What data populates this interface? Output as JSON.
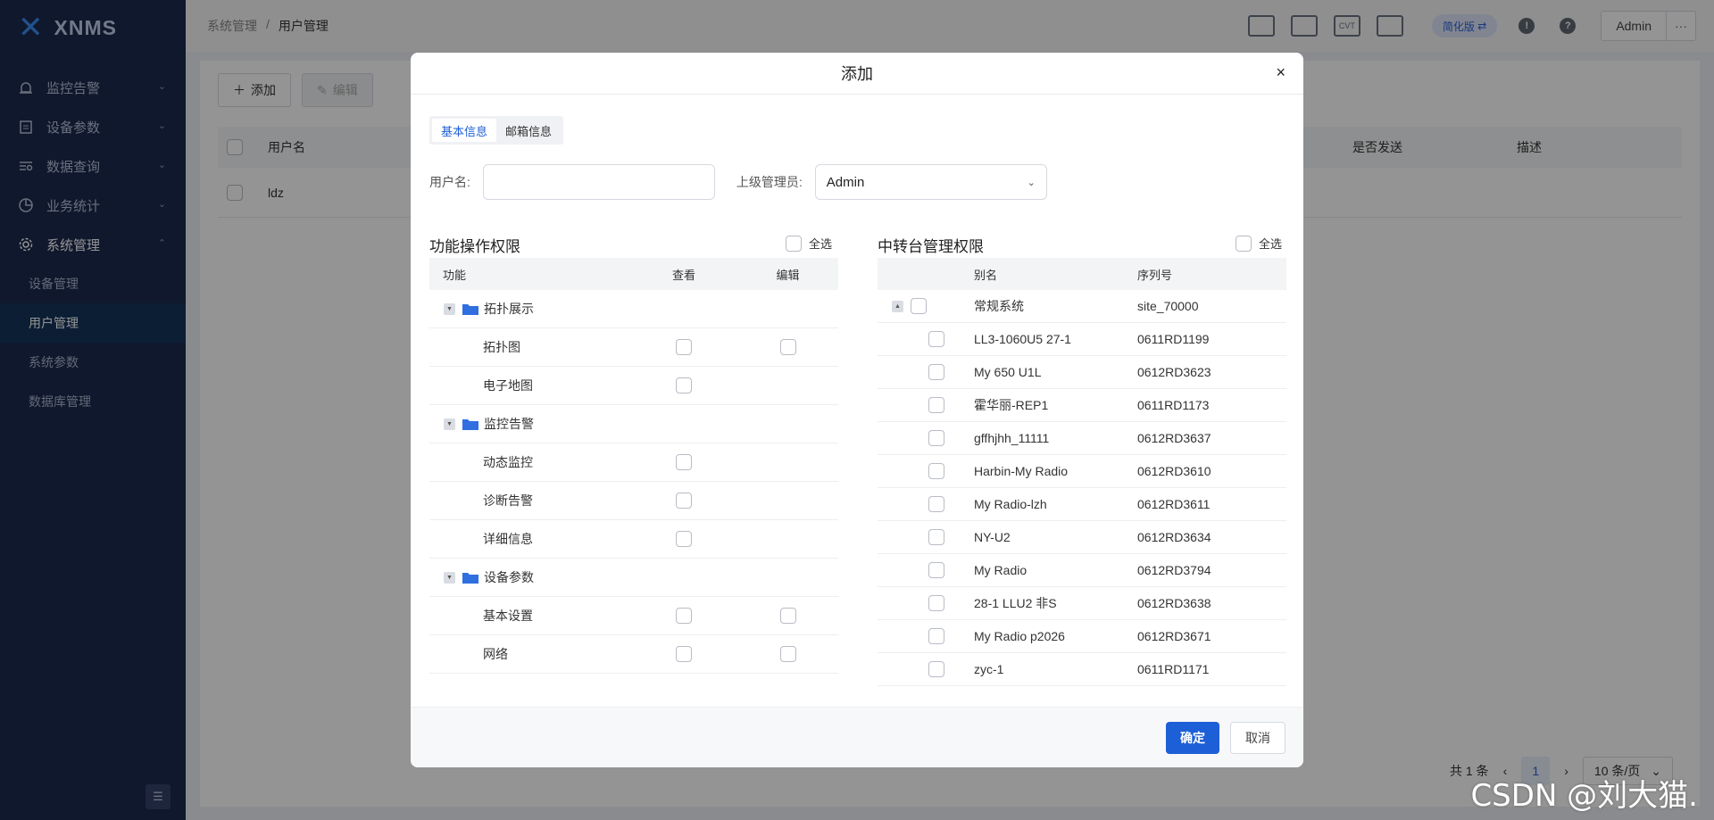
{
  "app": {
    "logo_text": "XNMS"
  },
  "sidebar": {
    "items": [
      {
        "label": "监控告警"
      },
      {
        "label": "设备参数"
      },
      {
        "label": "数据查询"
      },
      {
        "label": "业务统计"
      },
      {
        "label": "系统管理"
      }
    ],
    "subitems": [
      {
        "label": "设备管理"
      },
      {
        "label": "用户管理"
      },
      {
        "label": "系统参数"
      },
      {
        "label": "数据库管理"
      }
    ]
  },
  "breadcrumb": {
    "parent": "系统管理",
    "separator": "/",
    "current": "用户管理"
  },
  "topbar": {
    "simple_mode": "简化版",
    "user": "Admin",
    "more": "···",
    "cvt_label": "CVT"
  },
  "page": {
    "toolbar": {
      "add": "添加",
      "edit": "编辑"
    },
    "table": {
      "columns": [
        "用户名",
        "是否发送",
        "描述"
      ],
      "rows": [
        {
          "username": "ldz"
        }
      ]
    },
    "pagination": {
      "total": "共 1 条",
      "current": "1",
      "page_size": "10 条/页"
    }
  },
  "modal": {
    "title": "添加",
    "close": "×",
    "tabs": [
      "基本信息",
      "邮箱信息"
    ],
    "form": {
      "username_label": "用户名:",
      "username_value": "",
      "manager_label": "上级管理员:",
      "manager_value": "Admin"
    },
    "function_panel": {
      "title": "功能操作权限",
      "select_all": "全选",
      "columns": [
        "功能",
        "查看",
        "编辑"
      ],
      "groups": [
        {
          "name": "拓扑展示",
          "children": [
            "拓扑图",
            "电子地图"
          ]
        },
        {
          "name": "监控告警",
          "children": [
            "动态监控",
            "诊断告警",
            "详细信息"
          ]
        },
        {
          "name": "设备参数",
          "children": [
            "基本设置",
            "网络"
          ]
        }
      ]
    },
    "relay_panel": {
      "title": "中转台管理权限",
      "select_all": "全选",
      "columns": [
        "别名",
        "序列号"
      ],
      "group": {
        "alias": "常规系统",
        "serial": "site_70000"
      },
      "rows": [
        {
          "alias": "LL3-1060U5 27-1",
          "serial": "0611RD1199"
        },
        {
          "alias": "My 650 U1L",
          "serial": "0612RD3623"
        },
        {
          "alias": "霍华丽-REP1",
          "serial": "0611RD1173"
        },
        {
          "alias": "gffhjhh_11111",
          "serial": "0612RD3637"
        },
        {
          "alias": "Harbin-My Radio",
          "serial": "0612RD3610"
        },
        {
          "alias": "My Radio-lzh",
          "serial": "0612RD3611"
        },
        {
          "alias": "NY-U2",
          "serial": "0612RD3634"
        },
        {
          "alias": "My Radio",
          "serial": "0612RD3794"
        },
        {
          "alias": "28-1 LLU2 非S",
          "serial": "0612RD3638"
        },
        {
          "alias": "My Radio p2026",
          "serial": "0612RD3671"
        },
        {
          "alias": "zyc-1",
          "serial": "0611RD1171"
        }
      ]
    },
    "footer": {
      "confirm": "确定",
      "cancel": "取消"
    }
  },
  "watermark": "CSDN @刘大猫.",
  "colors": {
    "sidebar_bg": "#1b2a4e",
    "primary": "#1d5fd6",
    "overlay": "rgba(0,0,0,0.42)"
  }
}
